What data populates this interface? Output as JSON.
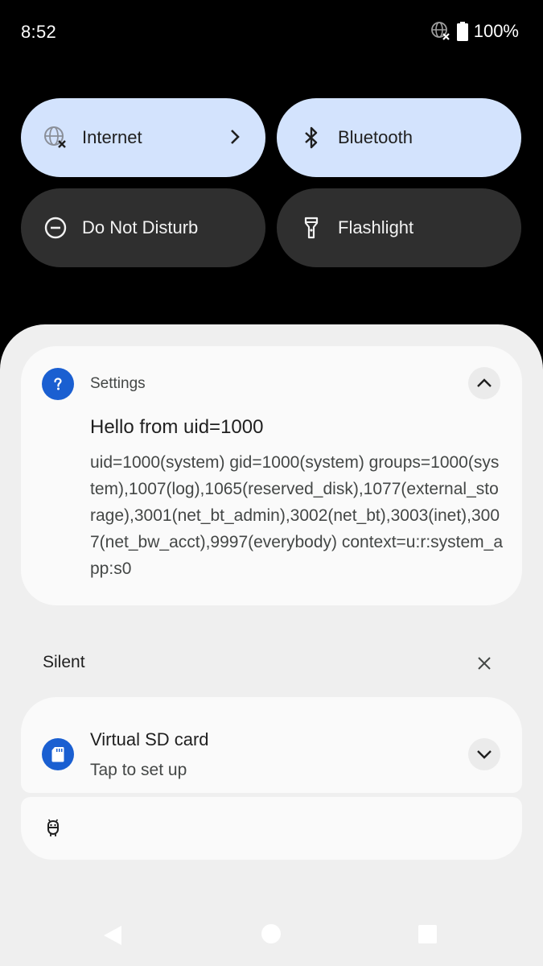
{
  "status_bar": {
    "time": "8:52",
    "battery_percent": "100%",
    "network_icon": "globe-no-connection-icon",
    "battery_icon": "battery-full-icon"
  },
  "quick_settings": {
    "tiles": [
      {
        "label": "Internet",
        "icon": "globe-icon",
        "state": "on",
        "has_chevron": true
      },
      {
        "label": "Bluetooth",
        "icon": "bluetooth-icon",
        "state": "on"
      },
      {
        "label": "Do Not Disturb",
        "icon": "do-not-disturb-icon",
        "state": "off"
      },
      {
        "label": "Flashlight",
        "icon": "flashlight-icon",
        "state": "off"
      }
    ],
    "active_color": "#d3e3fd",
    "inactive_color": "#2f2f2f"
  },
  "notifications": {
    "settings": {
      "app_name": "Settings",
      "app_icon": "question-mark-icon",
      "title": "Hello from uid=1000",
      "body": "uid=1000(system) gid=1000(system) groups=1000(system),1007(log),1065(reserved_disk),1077(external_storage),3001(net_bt_admin),3002(net_bt),3003(inet),3007(net_bw_acct),9997(everybody) context=u:r:system_app:s0",
      "expanded": true
    },
    "silent_section": {
      "header": "Silent"
    },
    "sd_card": {
      "title": "Virtual SD card",
      "subtitle": "Tap to set up",
      "app_icon": "sd-card-icon",
      "expanded": false
    },
    "collapsed_item": {
      "icon": "android-debug-icon"
    }
  },
  "navigation": {
    "back": "back-icon",
    "home": "home-icon",
    "recents": "recents-icon"
  },
  "colors": {
    "accent": "#1a5fd1",
    "shade_background": "#efefef",
    "card_background": "#fafafa"
  }
}
